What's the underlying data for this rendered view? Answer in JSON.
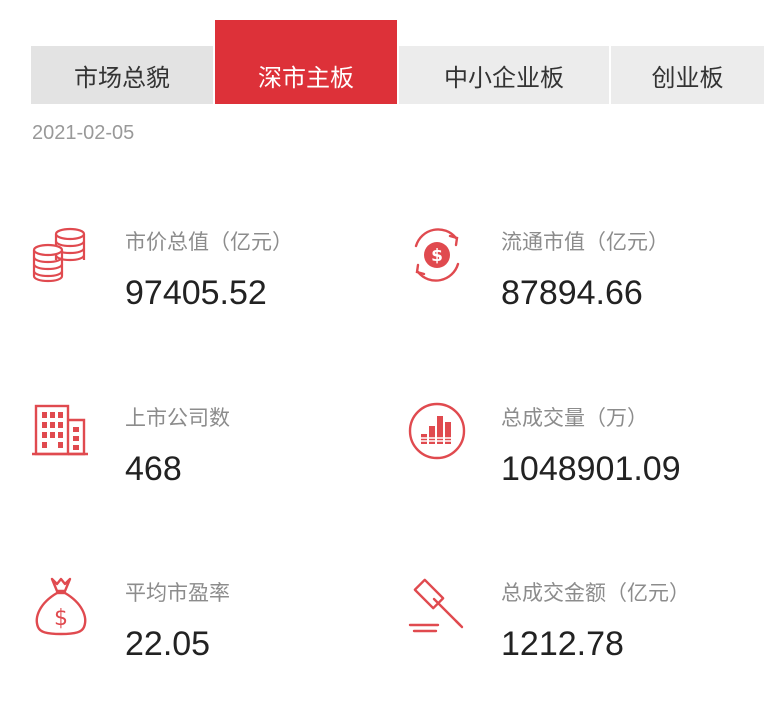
{
  "tabs": [
    {
      "label": "市场总貌",
      "active": false
    },
    {
      "label": "深市主板",
      "active": true
    },
    {
      "label": "中小企业板",
      "active": false
    },
    {
      "label": "创业板",
      "active": false
    }
  ],
  "date": "2021-02-05",
  "colors": {
    "accent": "#dd3139",
    "icon": "#e04a4f",
    "label": "#8c8c8c",
    "value": "#222222"
  },
  "stats": [
    {
      "icon": "coin-stack-icon",
      "label": "市价总值（亿元）",
      "value": "97405.52"
    },
    {
      "icon": "dollar-cycle-icon",
      "label": "流通市值（亿元）",
      "value": "87894.66"
    },
    {
      "icon": "building-icon",
      "label": "上市公司数",
      "value": "468"
    },
    {
      "icon": "bar-chart-circle-icon",
      "label": "总成交量（万）",
      "value": "1048901.09"
    },
    {
      "icon": "money-bag-icon",
      "label": "平均市盈率",
      "value": "22.05"
    },
    {
      "icon": "gavel-icon",
      "label": "总成交金额（亿元）",
      "value": "1212.78"
    }
  ]
}
